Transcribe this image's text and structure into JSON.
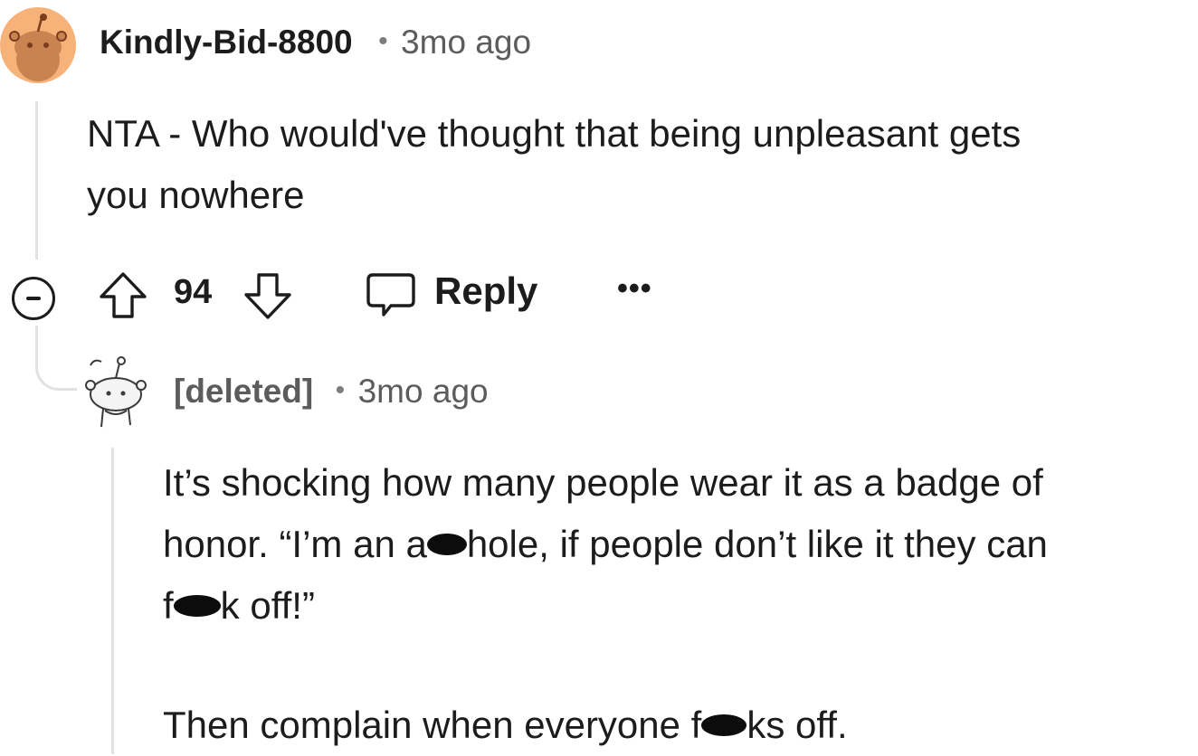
{
  "comment": {
    "author": "Kindly-Bid-8800",
    "separator": "•",
    "time": "3mo ago",
    "body_line1": "NTA - Who would've thought that being unpleasant gets",
    "body_line2": "you nowhere",
    "actions": {
      "score": "94",
      "reply_label": "Reply",
      "more_label": "•••",
      "collapse_icon": "minus-circle-icon",
      "upvote_icon": "arrow-up-icon",
      "downvote_icon": "arrow-down-icon",
      "reply_icon": "speech-bubble-icon"
    }
  },
  "reply": {
    "author": "[deleted]",
    "separator": "•",
    "time": "3mo ago",
    "line1": "It’s shocking how many people wear it as a badge of",
    "line2_a": "honor. “I’m an a",
    "line2_b": "hole, if people don’t like it they can",
    "line3_a": "f",
    "line3_b": "k off!”",
    "line4_a": "Then complain when everyone f",
    "line4_b": "ks off."
  },
  "colors": {
    "avatar_bg": "#f7b27a",
    "avatar_detail": "#b06a3a",
    "thread_line": "#e2e2e2",
    "text": "#1c1c1c",
    "muted": "#5c5c5c",
    "censor_blot": "#0c0c0c"
  }
}
